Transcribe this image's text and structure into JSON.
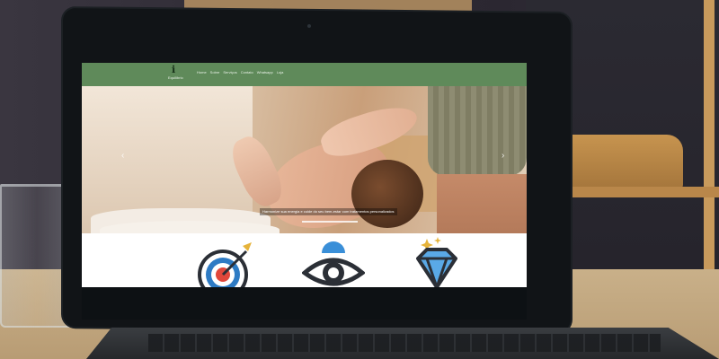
{
  "site": {
    "logo_mark": "ℹ",
    "brand": "Equilíbrio",
    "nav": [
      "Home",
      "Sobre",
      "Serviços",
      "Contato",
      "Whatsapp",
      "Loja"
    ],
    "hero_caption": "Harmonize sua energia e cuide do seu bem-estar com tratamentos personalizados",
    "prev_arrow": "‹",
    "next_arrow": "›"
  },
  "features": {
    "icons": [
      "target-icon",
      "eye-gear-icon",
      "diamond-sparkle-icon"
    ]
  },
  "colors": {
    "nav_bg": "#5f8a5a",
    "accent_red": "#e0473b",
    "accent_blue": "#2e7bc4",
    "gem_blue": "#5aa9e6",
    "sparkle": "#e6b33a"
  }
}
